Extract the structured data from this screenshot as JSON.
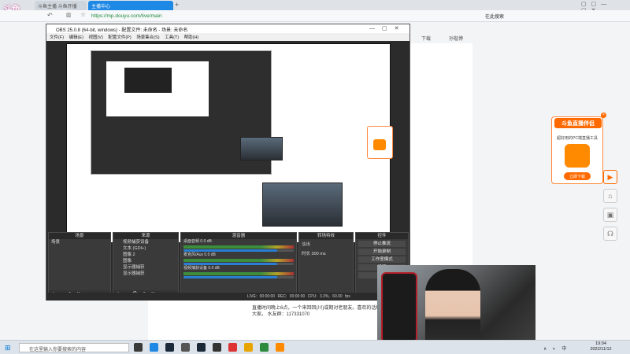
{
  "browser": {
    "logo": "斗鱼",
    "tabs": [
      "斗鱼主播 斗鱼开播",
      "主播中心"
    ],
    "url": "https://mp.douyu.com/live/main",
    "search_label": "在此搜索",
    "download_label": "下载",
    "user_label": "孙楷博"
  },
  "obs": {
    "title": "OBS 25.0.8 (64-bit, windows) - 配置文件: 未命名 - 场景: 未命名",
    "menu": [
      "文件(F)",
      "编辑(E)",
      "视图(V)",
      "配置文件(P)",
      "场景集合(S)",
      "工具(T)",
      "帮助(H)"
    ],
    "docks": {
      "scenes": "场景",
      "sources": "来源",
      "mixer": "混音器",
      "transitions": "转场特效",
      "controls": "控件"
    },
    "scene_item": "场景",
    "sources": [
      "视频捕获设备",
      "文本 (GDI+)",
      "图像 2",
      "图像",
      "显示器捕获",
      "显示器捕获"
    ],
    "mixer": [
      {
        "label": "桌面音频",
        "value": "0.0 dB"
      },
      {
        "label": "麦克风/Aux",
        "value": "0.0 dB"
      },
      {
        "label": "视频捕获设备",
        "value": "0.0 dB"
      }
    ],
    "transition": "淡出",
    "duration_label": "时长",
    "duration": "300 ms",
    "controls": [
      "停止推流",
      "开始录制",
      "工作室模式",
      "设置",
      "退出"
    ],
    "status": "LIVE: 00:00:00   REC: 00:00:00   CPU: 3.3%, 60.00 fps"
  },
  "page": {
    "line1": "直播时间晚上6点，一个来回回(川)或期对老朋友。喜欢的话给个",
    "line2": "大家。 水友群：117331070"
  },
  "promo": {
    "title": "斗鱼直播伴侣",
    "subtitle": "超好用的PC端直播工具",
    "button": "立即下载",
    "app": "直播伴侣"
  },
  "taskbar": {
    "search_placeholder": "在这里输入你要搜索的内容",
    "time": "19:04",
    "date": "2022/11/12",
    "lang": "中"
  },
  "colors": {
    "accent": "#ff6a00",
    "tab_active": "#1e88e5",
    "obs_bg": "#2b2b2b"
  }
}
